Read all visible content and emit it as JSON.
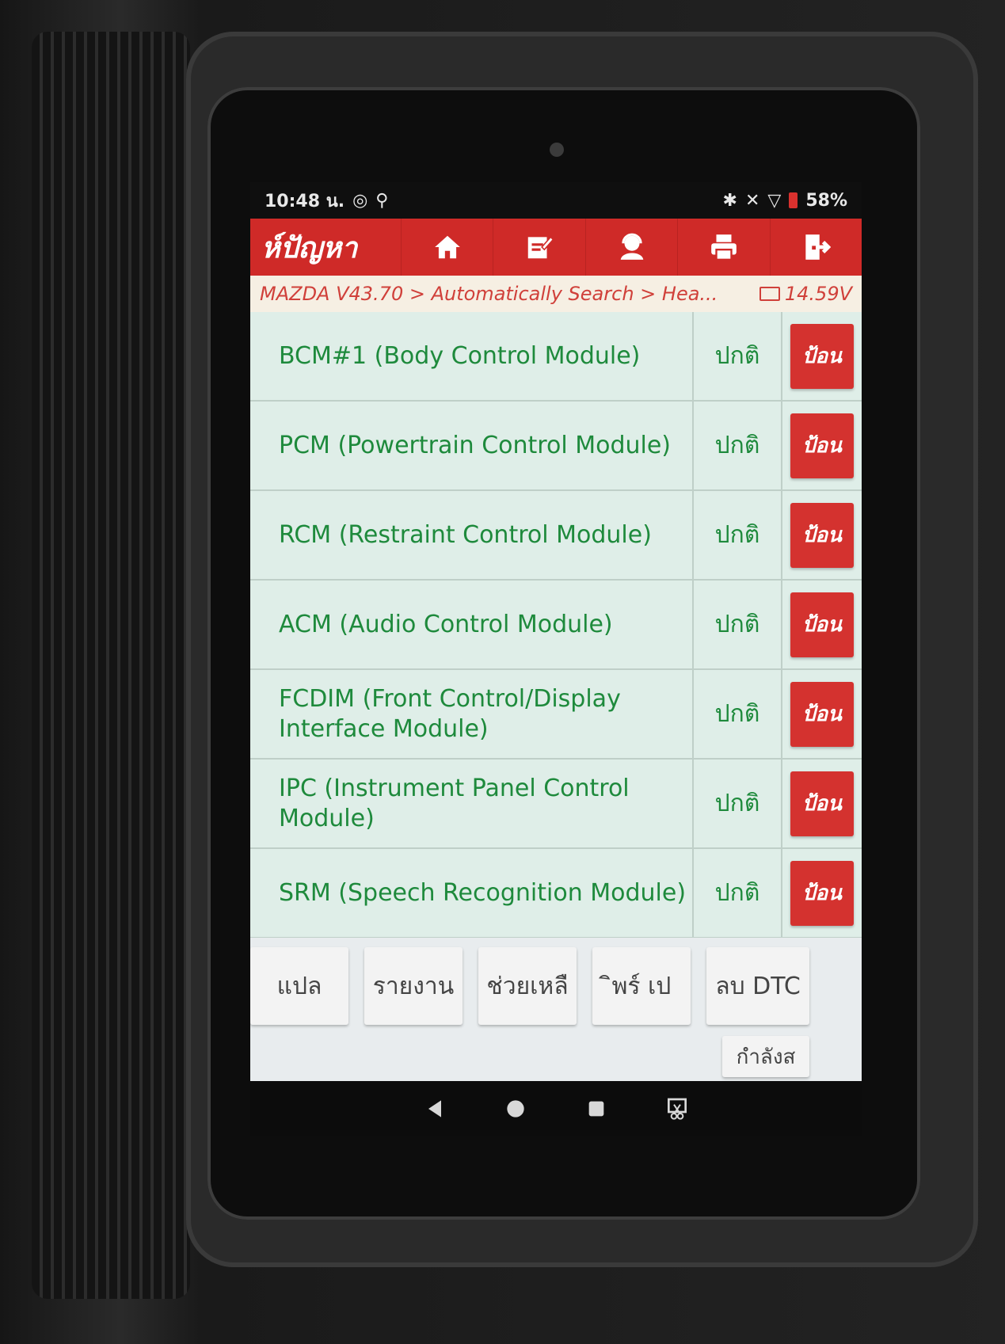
{
  "status_bar": {
    "time": "10:48 น.",
    "battery": "58%"
  },
  "toolbar": {
    "title": "ห์ปัญหา",
    "icons": [
      "home-icon",
      "edit-icon",
      "user-support-icon",
      "print-icon",
      "exit-icon"
    ]
  },
  "breadcrumb": {
    "path": "MAZDA V43.70 > Automatically Search > Hea...",
    "voltage": "14.59V"
  },
  "modules": [
    {
      "name": "BCM#1 (Body Control Module)",
      "status": "ปกติ",
      "action": "ป้อน"
    },
    {
      "name": "PCM (Powertrain Control Module)",
      "status": "ปกติ",
      "action": "ป้อน"
    },
    {
      "name": "RCM (Restraint Control Module)",
      "status": "ปกติ",
      "action": "ป้อน"
    },
    {
      "name": "ACM (Audio Control Module)",
      "status": "ปกติ",
      "action": "ป้อน"
    },
    {
      "name": "FCDIM (Front Control/Display Interface Module)",
      "status": "ปกติ",
      "action": "ป้อน"
    },
    {
      "name": "IPC (Instrument Panel Control Module)",
      "status": "ปกติ",
      "action": "ป้อน"
    },
    {
      "name": "SRM (Speech Recognition Module)",
      "status": "ปกติ",
      "action": "ป้อน"
    }
  ],
  "bottom_buttons": {
    "translate": "แปล",
    "report": "รายงาน",
    "help": "ช่วยเหลื",
    "print": "ิพร์ เป",
    "clear_dtc": "ลบ DTC",
    "loading": "กำลังส"
  },
  "colors": {
    "brand_red": "#cf2a28",
    "module_text_green": "#1e8a3c"
  }
}
